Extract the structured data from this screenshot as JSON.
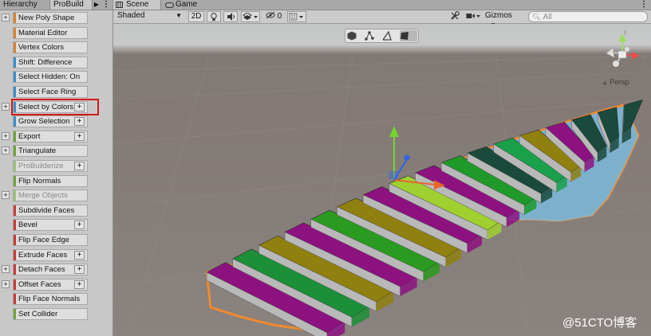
{
  "left_panel": {
    "tabs": {
      "hierarchy": "Hierarchy",
      "probuilder": "ProBuild"
    },
    "items": [
      {
        "label": "New Poly Shape",
        "color": "#d8832f",
        "has_fold": true,
        "has_options": false,
        "enabled": true
      },
      {
        "label": "Material Editor",
        "color": "#d8832f",
        "has_fold": false,
        "has_options": false,
        "enabled": true
      },
      {
        "label": "Vertex Colors",
        "color": "#d8832f",
        "has_fold": false,
        "has_options": false,
        "enabled": true
      },
      {
        "label": "Shift: Difference",
        "color": "#3a8fc7",
        "has_fold": false,
        "has_options": false,
        "enabled": true
      },
      {
        "label": "Select Hidden: On",
        "color": "#3a8fc7",
        "has_fold": false,
        "has_options": false,
        "enabled": true
      },
      {
        "label": "Select Face Ring",
        "color": "#3a8fc7",
        "has_fold": false,
        "has_options": false,
        "enabled": true
      },
      {
        "label": "Select by Colors",
        "color": "#3a8fc7",
        "has_fold": true,
        "has_options": true,
        "enabled": true
      },
      {
        "label": "Grow Selection",
        "color": "#3a8fc7",
        "has_fold": false,
        "has_options": true,
        "enabled": true
      },
      {
        "label": "Export",
        "color": "#6fa33a",
        "has_fold": true,
        "has_options": true,
        "enabled": true
      },
      {
        "label": "Triangulate",
        "color": "#6fa33a",
        "has_fold": true,
        "has_options": false,
        "enabled": true
      },
      {
        "label": "ProBuilderize",
        "color": "#9cc47a",
        "has_fold": false,
        "has_options": true,
        "enabled": false
      },
      {
        "label": "Flip Normals",
        "color": "#6fa33a",
        "has_fold": false,
        "has_options": false,
        "enabled": true
      },
      {
        "label": "Merge Objects",
        "color": "#9cc47a",
        "has_fold": true,
        "has_options": false,
        "enabled": false
      },
      {
        "label": "Subdivide Faces",
        "color": "#c83a3a",
        "has_fold": false,
        "has_options": false,
        "enabled": true
      },
      {
        "label": "Bevel",
        "color": "#c83a3a",
        "has_fold": false,
        "has_options": true,
        "enabled": true
      },
      {
        "label": "Flip Face Edge",
        "color": "#c83a3a",
        "has_fold": false,
        "has_options": false,
        "enabled": true
      },
      {
        "label": "Extrude Faces",
        "color": "#c83a3a",
        "has_fold": false,
        "has_options": true,
        "enabled": true
      },
      {
        "label": "Detach Faces",
        "color": "#c83a3a",
        "has_fold": true,
        "has_options": true,
        "enabled": true
      },
      {
        "label": "Offset Faces",
        "color": "#c83a3a",
        "has_fold": true,
        "has_options": true,
        "enabled": true
      },
      {
        "label": "Flip Face Normals",
        "color": "#c83a3a",
        "has_fold": false,
        "has_options": false,
        "enabled": true
      },
      {
        "label": "Set Collider",
        "color": "#6fa33a",
        "has_fold": false,
        "has_options": false,
        "enabled": true
      }
    ],
    "highlighted_item": "Select by Colors",
    "highlight_color": "#d21a1a"
  },
  "scene_tabs": {
    "scene": "Scene",
    "game": "Game"
  },
  "toolbar": {
    "shading_mode": "Shaded",
    "mode_2d": "2D",
    "hidden_count": "0",
    "gizmos": "Gizmos",
    "search_placeholder": "All"
  },
  "viewport": {
    "projection_label": "Persp",
    "watermark": "@51CTO博客",
    "step_colors": [
      "#8d1280",
      "#1c8f38",
      "#8f8010",
      "#8d1280",
      "#2a9a20",
      "#8f8010",
      "#8d1280",
      "#a0d030",
      "#8d1280",
      "#1f9a2a",
      "#1a4a3c",
      "#1aa04a",
      "#8f8010",
      "#8d1280",
      "#1a4a3c",
      "#1a4a3c",
      "#1a4a3c"
    ],
    "selection_color": "#f08a30"
  }
}
